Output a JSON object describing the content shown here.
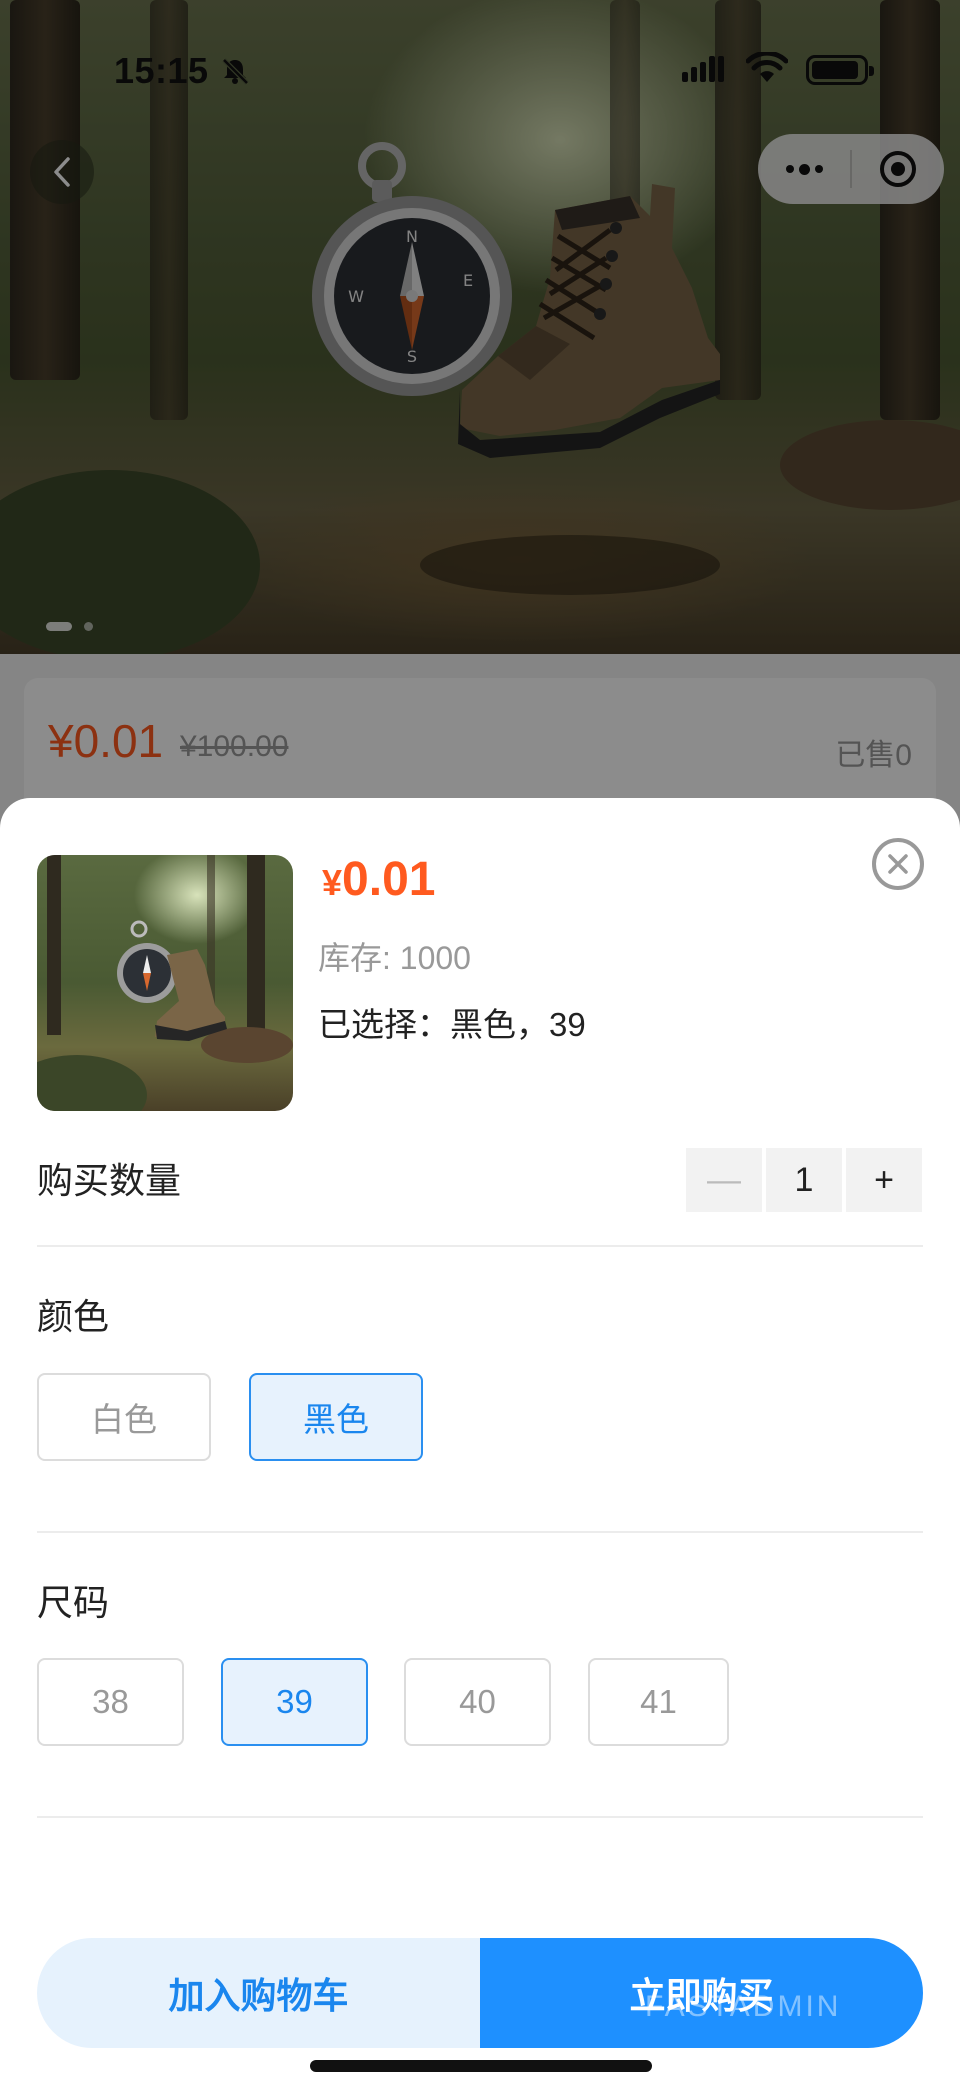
{
  "status_bar": {
    "time": "15:15"
  },
  "hero": {
    "active_slide": 1,
    "slide_count": 2
  },
  "product_behind": {
    "price": "¥0.01",
    "original_price": "¥100.00",
    "sold": "已售0"
  },
  "sheet": {
    "currency": "¥",
    "price": "0.01",
    "stock": "库存: 1000",
    "selected": "已选择：黑色，39",
    "quantity_label": "购买数量",
    "quantity_minus": "—",
    "quantity": "1",
    "quantity_plus": "+",
    "color_title": "颜色",
    "colors": [
      "白色",
      "黑色"
    ],
    "selected_color": "黑色",
    "size_title": "尺码",
    "sizes": [
      "38",
      "39",
      "40",
      "41"
    ],
    "selected_size": "39",
    "add_to_cart": "加入购物车",
    "buy_now": "立即购买",
    "watermark": "FASTADMIN"
  },
  "colors": {
    "accent": "#1e90ff",
    "price": "#ff5a1f",
    "selected_bg": "#e7f2fd"
  }
}
